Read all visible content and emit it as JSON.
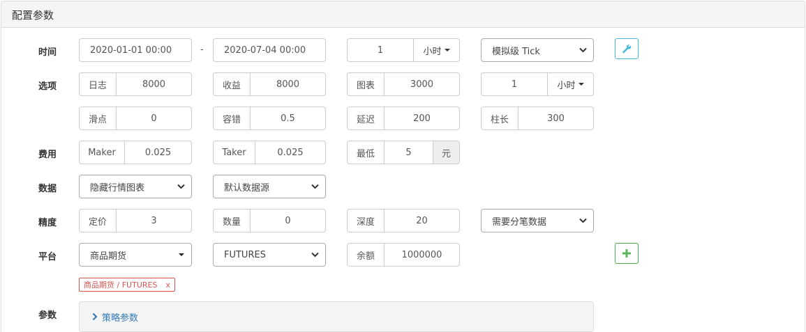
{
  "panel": {
    "title": "配置参数"
  },
  "labels": {
    "time": "时间",
    "options": "选项",
    "fee": "费用",
    "data": "数据",
    "precision": "精度",
    "platform": "平台",
    "params": "参数"
  },
  "time": {
    "start": "2020-01-01 00:00",
    "separator": "-",
    "end": "2020-07-04 00:00",
    "period_value": "1",
    "period_unit": "小时",
    "mode": "模拟级 Tick"
  },
  "options": {
    "log_label": "日志",
    "log_value": "8000",
    "profit_label": "收益",
    "profit_value": "8000",
    "chart_label": "图表",
    "chart_value": "3000",
    "base_period_value": "1",
    "base_period_unit": "小时",
    "slippage_label": "滑点",
    "slippage_value": "0",
    "tolerance_label": "容错",
    "tolerance_value": "0.5",
    "delay_label": "延迟",
    "delay_value": "200",
    "bar_label": "柱长",
    "bar_value": "300"
  },
  "fee": {
    "maker_label": "Maker",
    "maker_value": "0.025",
    "taker_label": "Taker",
    "taker_value": "0.025",
    "min_label": "最低",
    "min_value": "5",
    "min_unit": "元"
  },
  "data": {
    "chart_select": "隐藏行情图表",
    "source_select": "默认数据源"
  },
  "precision": {
    "price_label": "定价",
    "price_value": "3",
    "qty_label": "数量",
    "qty_value": "0",
    "depth_label": "深度",
    "depth_value": "20",
    "trade_select": "需要分笔数据"
  },
  "platform": {
    "exchange_select": "商品期货",
    "market_select": "FUTURES",
    "balance_label": "余额",
    "balance_value": "1000000",
    "tag_text": "商品期货 / FUTURES",
    "tag_close": "x"
  },
  "params": {
    "strategy_label": "策略参数"
  },
  "colors": {
    "info": "#46b8da",
    "success": "#5cb85c",
    "danger": "#d9534f",
    "link": "#337ab7"
  },
  "icons": {
    "settings_button": "wrench-icon",
    "add_button": "plus-icon",
    "collapse": "chevron-right-icon"
  }
}
